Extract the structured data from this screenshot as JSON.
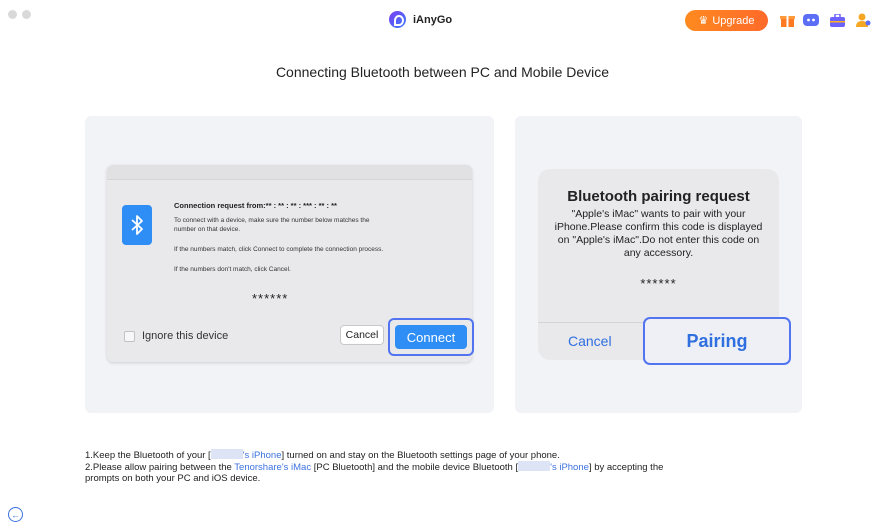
{
  "window": {
    "app_name": "iAnyGo"
  },
  "header": {
    "upgrade_label": "Upgrade",
    "icons": [
      "gift-icon",
      "discord-icon",
      "toolbox-icon",
      "user-icon"
    ],
    "accent": "#ff7a22"
  },
  "page": {
    "title": "Connecting Bluetooth between PC and Mobile Device"
  },
  "pc_dialog": {
    "request_title": "Connection request from:** : ** : ** : *** : ** : **",
    "line1": "To connect with a device, make sure the number below matches the",
    "line1b": "number on that device.",
    "line2": "If the numbers match, click Connect to complete the connection process.",
    "line3": "If the numbers don't match, click Cancel.",
    "code": "******",
    "ignore_label": "Ignore this device",
    "cancel_label": "Cancel",
    "connect_label": "Connect"
  },
  "ios_dialog": {
    "title": "Bluetooth pairing request",
    "message": "\"Apple's iMac\" wants to pair with your iPhone.Please confirm this code is displayed on \"Apple's iMac\".Do not enter this code on any accessory.",
    "code": "******",
    "cancel_label": "Cancel",
    "pairing_label": "Pairing"
  },
  "notes": {
    "n1_prefix": "1.Keep the Bluetooth of your [",
    "n1_link": "'s iPhone",
    "n1_suffix": "] turned on and stay on the Bluetooth settings page of your phone.",
    "n2_prefix": "2.Please allow pairing between the ",
    "n2_link1": "Tenorshare's iMac",
    "n2_mid": " [PC Bluetooth] and the mobile device Bluetooth [",
    "n2_link2": "'s iPhone",
    "n2_suffix": "] by accepting the",
    "n2_line2": "prompts on both your PC and iOS device."
  }
}
